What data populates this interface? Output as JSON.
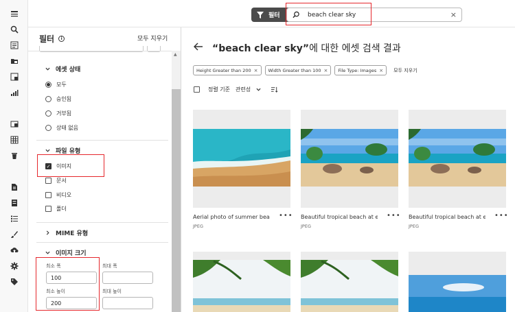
{
  "toolbar": {
    "filter_label": "필터",
    "search_value": "beach clear sky"
  },
  "rail": {
    "icons": [
      "menu-icon",
      "search-icon",
      "list-icon",
      "folder-icon",
      "board-icon",
      "chart-icon",
      "image-icon",
      "grid-icon",
      "trash-icon",
      "document-icon",
      "form-icon",
      "tasks-icon",
      "brush-icon",
      "upload-icon",
      "gear-icon",
      "tag-icon"
    ]
  },
  "filters": {
    "title": "필터",
    "clear_all": "모두 지우기",
    "asset_status": {
      "heading": "에셋 상태",
      "options": [
        {
          "label": "모두",
          "selected": true
        },
        {
          "label": "승인됨",
          "selected": false
        },
        {
          "label": "거부됨",
          "selected": false
        },
        {
          "label": "상태 없음",
          "selected": false
        }
      ]
    },
    "file_type": {
      "heading": "파일 유형",
      "options": [
        {
          "label": "이미지",
          "checked": true
        },
        {
          "label": "문서",
          "checked": false
        },
        {
          "label": "비디오",
          "checked": false
        },
        {
          "label": "폴더",
          "checked": false
        }
      ]
    },
    "mime": {
      "heading": "MIME 유형"
    },
    "image_size": {
      "heading": "이미지 크기",
      "min_width_label": "최소 폭",
      "max_width_label": "최대 폭",
      "min_height_label": "최소 높이",
      "max_height_label": "최대 높이",
      "min_width": "100",
      "max_width": "",
      "min_height": "200",
      "max_height": ""
    }
  },
  "main": {
    "query": "“beach clear sky”",
    "title_suffix": "에 대한 에셋 검색 결과",
    "chips": [
      {
        "label": "Height Greater than 200"
      },
      {
        "label": "Width Greater than 100"
      },
      {
        "label": "File Type: Images"
      }
    ],
    "chips_clear": "모두 지우기",
    "sort_label": "정렬 기준",
    "sort_value": "관련성",
    "cards": [
      {
        "title": "Aerial photo of summer beac...",
        "type": "JPEG"
      },
      {
        "title": "Beautiful tropical beach at ex...",
        "type": "JPEG"
      },
      {
        "title": "Beautiful tropical beach at ex...",
        "type": "JPEG"
      }
    ]
  },
  "colors": {
    "highlight_box": "#e5262b",
    "filter_button_bg": "#4b4b4b"
  }
}
